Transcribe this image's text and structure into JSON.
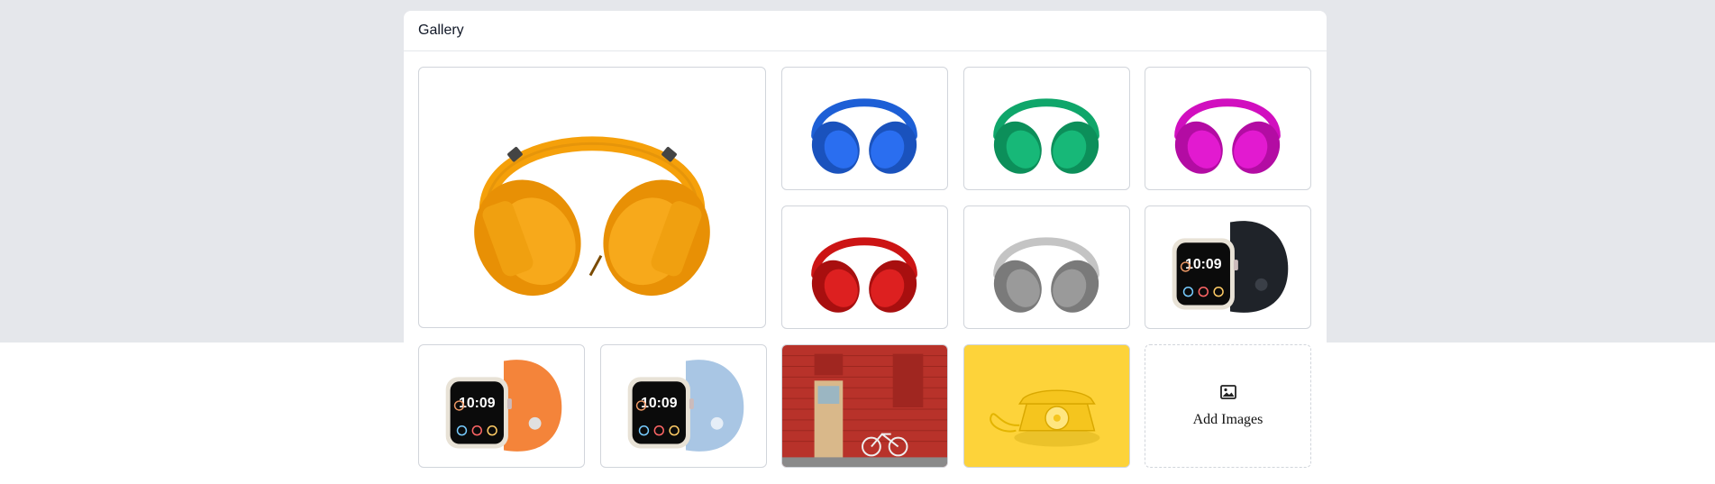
{
  "gallery": {
    "title": "Gallery",
    "add_images_label": "Add Images"
  },
  "images": [
    {
      "kind": "headphones",
      "color": "#f5a00a"
    },
    {
      "kind": "headphones",
      "color": "#1d5fd6"
    },
    {
      "kind": "headphones",
      "color": "#0fa66a"
    },
    {
      "kind": "headphones",
      "color": "#d10fbf"
    },
    {
      "kind": "headphones",
      "color": "#cc1414"
    },
    {
      "kind": "headphones",
      "color": "#b8b8b8"
    },
    {
      "kind": "watch",
      "band": "#1f2329",
      "time": "10:09"
    },
    {
      "kind": "watch",
      "band": "#f4843a",
      "time": "10:09"
    },
    {
      "kind": "watch",
      "band": "#a9c6e4",
      "time": "10:09"
    },
    {
      "kind": "photo",
      "subject": "red brick wall with door and bicycle"
    },
    {
      "kind": "photo",
      "subject": "yellow rotary telephone"
    }
  ],
  "icons": {
    "add_images": "image-icon"
  }
}
